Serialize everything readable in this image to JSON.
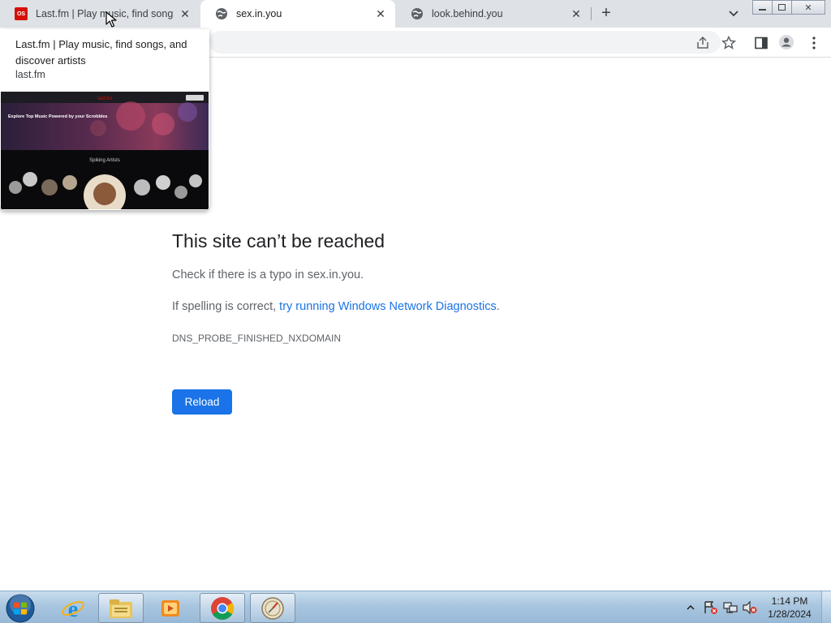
{
  "browser": {
    "tabs": [
      {
        "title": "Last.fm | Play music, find songs, a",
        "favicon": "lastfm-icon",
        "favicon_text": "OS",
        "active": false
      },
      {
        "title": "sex.in.you",
        "favicon": "globe-icon",
        "active": true
      },
      {
        "title": "look.behind.you",
        "favicon": "globe-icon",
        "active": false
      }
    ],
    "toolbar_icons": [
      "share-icon",
      "bookmark-star-icon",
      "side-panel-icon",
      "profile-icon",
      "menu-icon"
    ]
  },
  "hovercard": {
    "title": "Last.fm | Play music, find songs, and discover artists",
    "domain": "last.fm",
    "preview": {
      "brand": "last.fm",
      "heading": "Explore Top Music Powered by your Scrobbles",
      "section": "Spiking Artists"
    }
  },
  "error_page": {
    "title": "This site can’t be reached",
    "line1": "Check if there is a typo in sex.in.you.",
    "line2_prefix": "If spelling is correct, ",
    "line2_link": "try running Windows Network Diagnostics",
    "line2_suffix": ".",
    "code": "DNS_PROBE_FINISHED_NXDOMAIN",
    "reload_label": "Reload"
  },
  "taskbar": {
    "pinned": [
      "start-orb-icon",
      "internet-explorer-icon",
      "file-explorer-icon",
      "media-player-icon",
      "chrome-icon",
      "system-tool-icon"
    ],
    "clock_time": "1:14 PM",
    "clock_date": "1/28/2024"
  },
  "colors": {
    "accent": "#1a73e8",
    "tabstrip": "#dee1e6",
    "lastfm_red": "#d51007"
  }
}
